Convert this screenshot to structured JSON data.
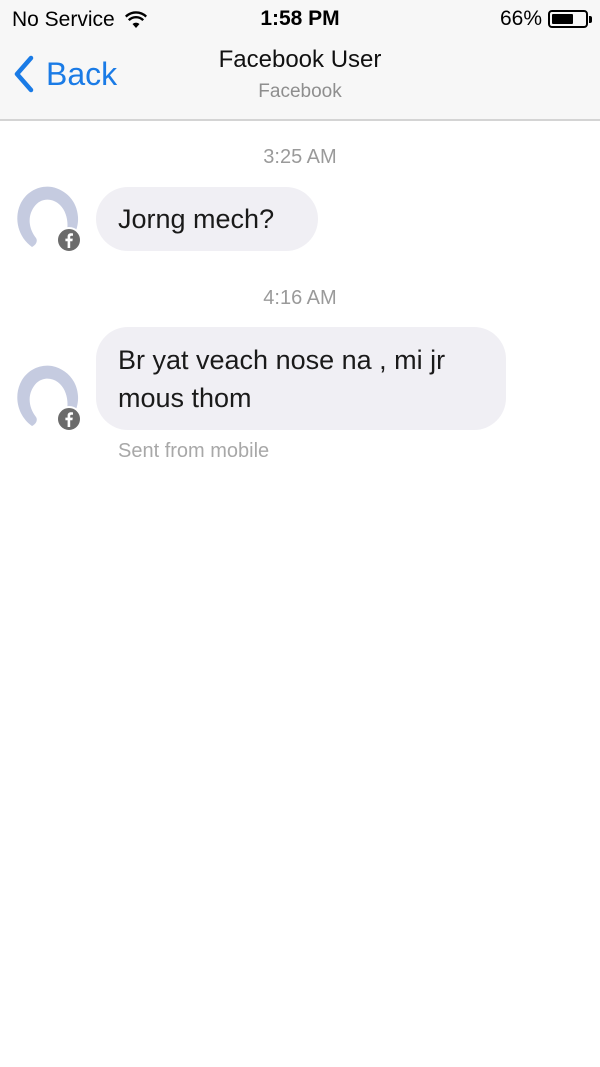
{
  "status_bar": {
    "carrier": "No Service",
    "time": "1:58 PM",
    "battery_percent": "66%",
    "battery_level": 0.66,
    "wifi_icon": "wifi-icon",
    "battery_icon": "battery-icon"
  },
  "nav": {
    "back_label": "Back",
    "back_icon": "chevron-left-icon",
    "title": "Facebook User",
    "subtitle": "Facebook"
  },
  "messages": [
    {
      "timestamp": "3:25 AM",
      "text": "Jorng mech?"
    },
    {
      "timestamp": "4:16 AM",
      "text_line1": "Br yat veach nose na , mi jr",
      "text_line2": "mous thom",
      "footer": "Sent from mobile"
    }
  ],
  "colors": {
    "accent": "#1a7be6",
    "bubble": "#f0eff4",
    "avatar": "#c5cbe0",
    "badge": "#6b6b6b"
  }
}
